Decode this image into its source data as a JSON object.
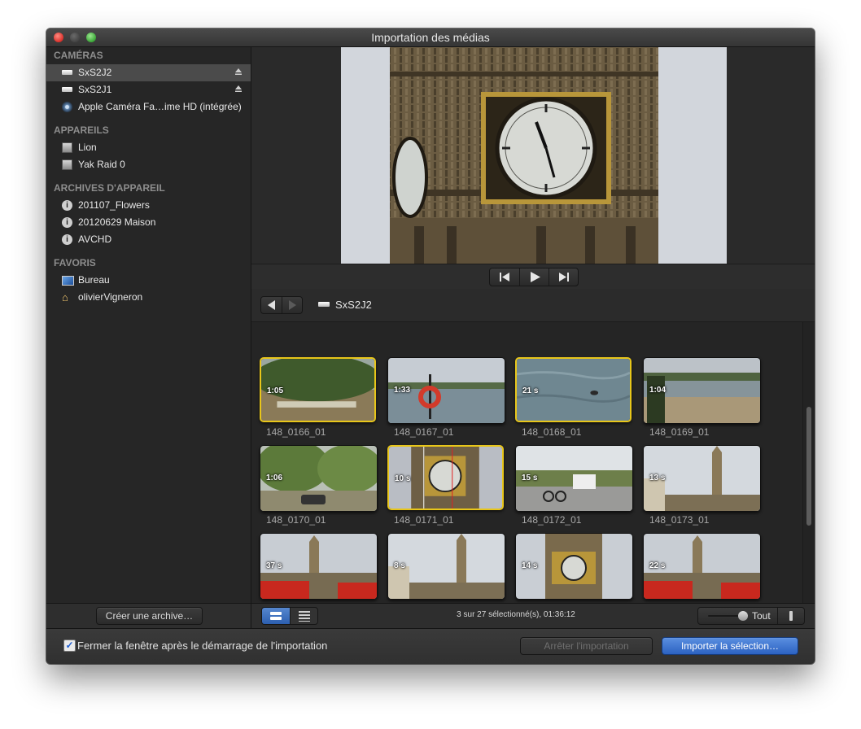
{
  "window": {
    "title": "Importation des médias"
  },
  "sidebar": {
    "sections": [
      {
        "title": "CAMÉRAS",
        "items": [
          {
            "label": "SxS2J2",
            "icon": "drive-icon",
            "selected": true,
            "eject": true
          },
          {
            "label": "SxS2J1",
            "icon": "drive-icon",
            "selected": false,
            "eject": true
          },
          {
            "label": "Apple Caméra Fa…ime HD (intégrée)",
            "icon": "webcam-icon",
            "selected": false,
            "eject": false
          }
        ]
      },
      {
        "title": "APPAREILS",
        "items": [
          {
            "label": "Lion",
            "icon": "hard-disk-icon"
          },
          {
            "label": "Yak Raid 0",
            "icon": "hard-disk-icon"
          }
        ]
      },
      {
        "title": "ARCHIVES D'APPAREIL",
        "items": [
          {
            "label": "201107_Flowers",
            "icon": "archive-icon"
          },
          {
            "label": "20120629 Maison",
            "icon": "archive-icon"
          },
          {
            "label": "AVCHD",
            "icon": "archive-icon"
          }
        ]
      },
      {
        "title": "FAVORIS",
        "items": [
          {
            "label": "Bureau",
            "icon": "desktop-icon"
          },
          {
            "label": "olivierVigneron",
            "icon": "home-icon"
          }
        ]
      }
    ],
    "create_archive_label": "Créer une archive…"
  },
  "browser": {
    "location": "SxS2J2",
    "clips": [
      {
        "name": "148_0166_01",
        "duration": "1:05",
        "selected": true,
        "scene": "park"
      },
      {
        "name": "148_0167_01",
        "duration": "1:33",
        "selected": false,
        "scene": "lake-buoy"
      },
      {
        "name": "148_0168_01",
        "duration": "21 s",
        "selected": true,
        "scene": "water"
      },
      {
        "name": "148_0169_01",
        "duration": "1:04",
        "selected": false,
        "scene": "lakeshore"
      },
      {
        "name": "148_0170_01",
        "duration": "1:06",
        "selected": false,
        "scene": "trees"
      },
      {
        "name": "148_0171_01",
        "duration": "10 s",
        "selected": true,
        "scene": "clock"
      },
      {
        "name": "148_0172_01",
        "duration": "15 s",
        "selected": false,
        "scene": "street"
      },
      {
        "name": "148_0173_01",
        "duration": "13 s",
        "selected": false,
        "scene": "tower-far"
      },
      {
        "name": "148_0174_01",
        "duration": "37 s",
        "selected": false,
        "scene": "bus"
      },
      {
        "name": "148_0175_01",
        "duration": "8 s",
        "selected": false,
        "scene": "tower-far"
      },
      {
        "name": "148_0176_01",
        "duration": "14 s",
        "selected": false,
        "scene": "clock-near"
      },
      {
        "name": "148_0177_01",
        "duration": "22 s",
        "selected": false,
        "scene": "bus"
      }
    ],
    "status": "3 sur 27 sélectionné(s), 01:36:12",
    "zoom_label": "Tout"
  },
  "footer": {
    "close_window_checked": true,
    "close_window_label": "Fermer la fenêtre après le démarrage de l'importation",
    "stop_import_label": "Arrêter l'importation",
    "import_selection_label": "Importer la sélection…"
  }
}
